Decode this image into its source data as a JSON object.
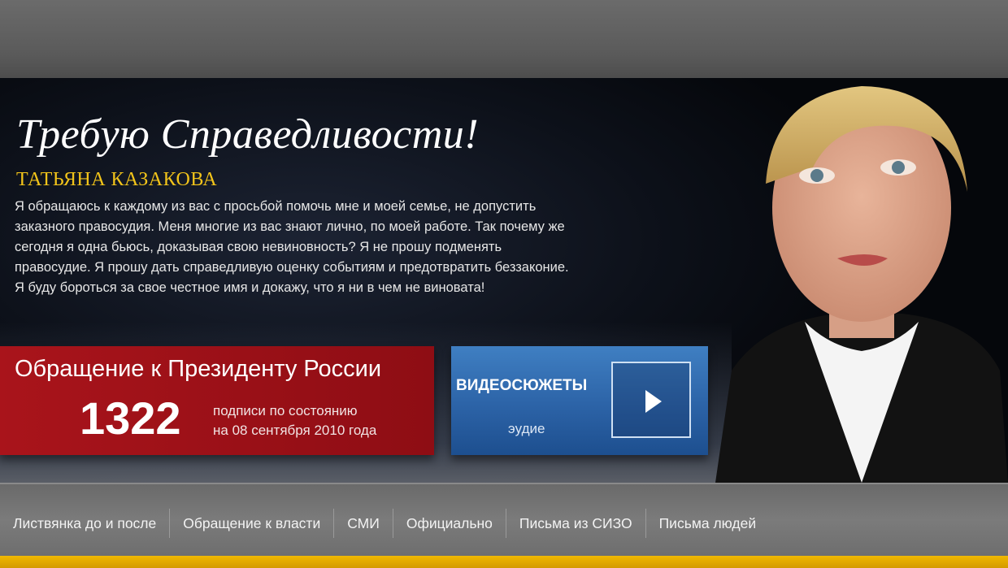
{
  "hero": {
    "headline": "Требую Справедливости!",
    "author": "ТАТЬЯНА КАЗАКОВА",
    "appeal_lines": [
      "Я обращаюсь к каждому из вас с просьбой помочь мне и моей семье, не допустить",
      "заказного правосудия. Меня многие из вас знают лично, по моей работе. Так почему же",
      "сегодня я одна бьюсь, доказывая свою невиновность? Я не прошу подменять",
      "правосудие. Я прошу дать справедливую оценку событиям и предотвратить беззаконие.",
      "Я буду бороться за свое честное имя и докажу, что я ни в чем не виновата!"
    ]
  },
  "petition": {
    "title": "Обращение к Президенту России",
    "count": "1322",
    "note_line1": "подписи по состоянию",
    "note_line2": "на 08 сентября 2010 года"
  },
  "video": {
    "label": "ВИДЕОСЮЖЕТЫ",
    "sub": "эудие",
    "play_icon": "play-icon"
  },
  "nav": {
    "items": [
      "Листвянка до и после",
      "Обращение к власти",
      "СМИ",
      "Официально",
      "Письма из СИЗО",
      "Письма людей"
    ]
  },
  "colors": {
    "accent_yellow": "#f2c41a",
    "petition_red": "#a9141b",
    "video_blue": "#2c63a7",
    "stripe_orange": "#f0b800"
  }
}
